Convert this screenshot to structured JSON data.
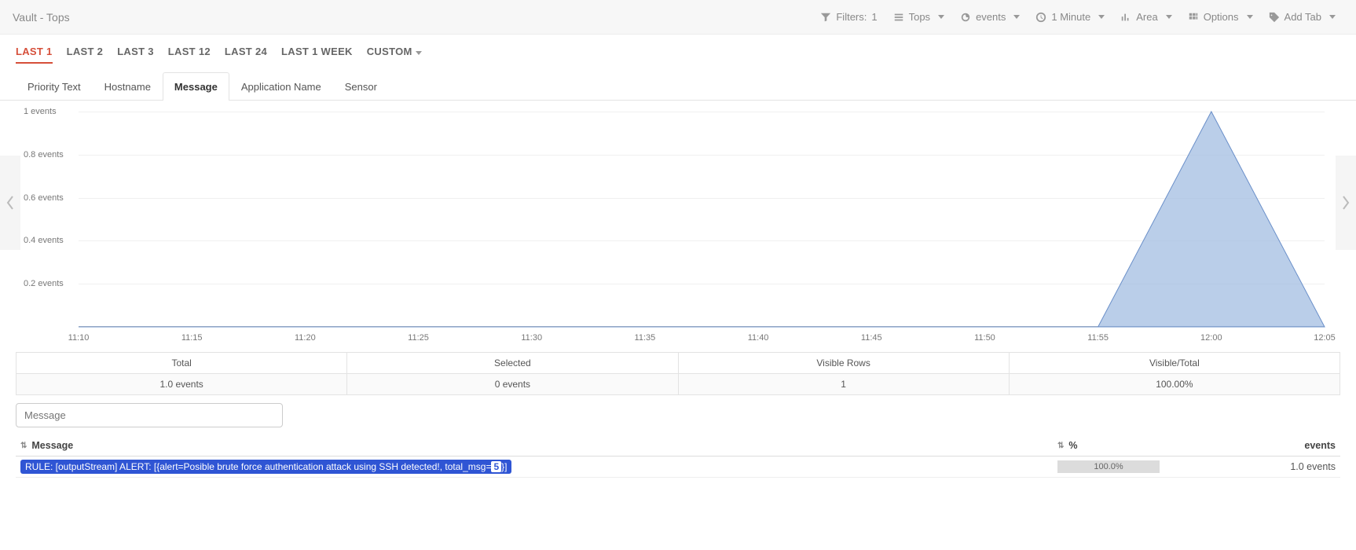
{
  "header": {
    "title": "Vault - Tops",
    "filters_label": "Filters:",
    "filters_count": "1",
    "tops_label": "Tops",
    "events_label": "events",
    "interval_label": "1 Minute",
    "area_label": "Area",
    "options_label": "Options",
    "addtab_label": "Add Tab"
  },
  "ranges": {
    "last1": "LAST 1",
    "last2": "LAST 2",
    "last3": "LAST 3",
    "last12": "LAST 12",
    "last24": "LAST 24",
    "last1w": "LAST 1 WEEK",
    "custom": "CUSTOM"
  },
  "subtabs": {
    "priority": "Priority Text",
    "hostname": "Hostname",
    "message": "Message",
    "appname": "Application Name",
    "sensor": "Sensor"
  },
  "chart_data": {
    "type": "area",
    "title": "",
    "ylabel_unit": "events",
    "ylim": [
      0,
      1
    ],
    "yticks": [
      {
        "v": 0.2,
        "label": "0.2 events"
      },
      {
        "v": 0.4,
        "label": "0.4 events"
      },
      {
        "v": 0.6,
        "label": "0.6 events"
      },
      {
        "v": 0.8,
        "label": "0.8 events"
      },
      {
        "v": 1.0,
        "label": "1 events"
      }
    ],
    "categories": [
      "11:10",
      "11:15",
      "11:20",
      "11:25",
      "11:30",
      "11:35",
      "11:40",
      "11:45",
      "11:50",
      "11:55",
      "12:00",
      "12:05"
    ],
    "series": [
      {
        "name": "Message",
        "values": [
          0,
          0,
          0,
          0,
          0,
          0,
          0,
          0,
          0,
          0,
          1,
          0
        ]
      }
    ]
  },
  "summary": {
    "total_label": "Total",
    "total_value": "1.0 events",
    "selected_label": "Selected",
    "selected_value": "0 events",
    "visible_rows_label": "Visible Rows",
    "visible_rows_value": "1",
    "visible_total_label": "Visible/Total",
    "visible_total_value": "100.00%"
  },
  "filter": {
    "placeholder": "Message"
  },
  "table": {
    "col_message": "Message",
    "col_pct": "%",
    "col_events": "events",
    "row0": {
      "msg_prefix": "RULE: [outputStream] ALERT: [{alert=Posible brute force authentication attack using SSH detected!, total_msg=",
      "msg_highlight": "5",
      "msg_suffix": "}]",
      "pct": "100.0%",
      "events": "1.0 events"
    }
  }
}
